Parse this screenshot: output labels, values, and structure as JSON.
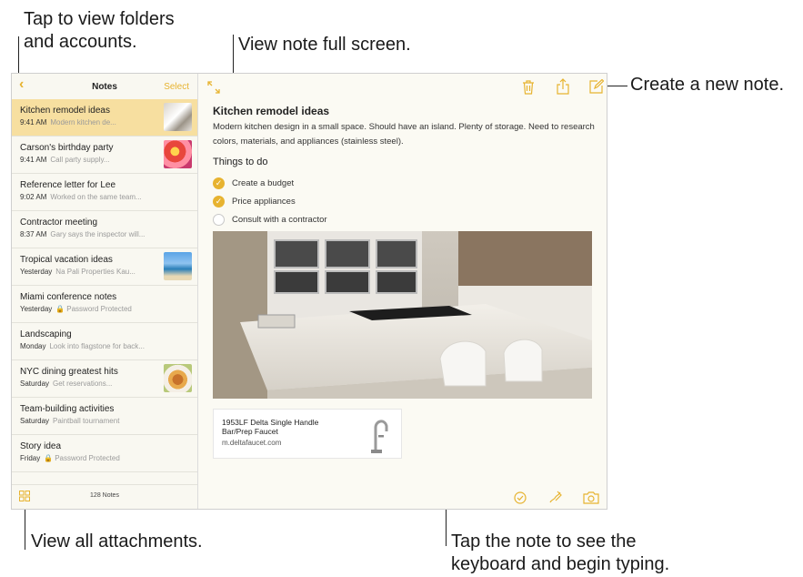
{
  "callouts": {
    "folders": "Tap to view folders\nand accounts.",
    "full_screen": "View note full screen.",
    "new_note": "Create a new note.",
    "attachments": "View all attachments.",
    "typing": "Tap the note to see the\nkeyboard and begin typing."
  },
  "sidebar": {
    "title": "Notes",
    "select_label": "Select",
    "note_count": "128 Notes",
    "notes": [
      {
        "title": "Kitchen remodel ideas",
        "time": "9:41 AM",
        "preview": "Modern kitchen de..."
      },
      {
        "title": "Carson's birthday party",
        "time": "9:41 AM",
        "preview": "Call party supply..."
      },
      {
        "title": "Reference letter for Lee",
        "time": "9:02 AM",
        "preview": "Worked on the same team..."
      },
      {
        "title": "Contractor meeting",
        "time": "8:37 AM",
        "preview": "Gary says the inspector will..."
      },
      {
        "title": "Tropical vacation ideas",
        "time": "Yesterday",
        "preview": "Na Pali Properties Kau..."
      },
      {
        "title": "Miami conference notes",
        "time": "Yesterday",
        "preview": "Password Protected"
      },
      {
        "title": "Landscaping",
        "time": "Monday",
        "preview": "Look into flagstone for back..."
      },
      {
        "title": "NYC dining greatest hits",
        "time": "Saturday",
        "preview": "Get reservations..."
      },
      {
        "title": "Team-building activities",
        "time": "Saturday",
        "preview": "Paintball tournament"
      },
      {
        "title": "Story idea",
        "time": "Friday",
        "preview": "Password Protected"
      }
    ]
  },
  "note": {
    "title": "Kitchen remodel ideas",
    "body": "Modern kitchen design in a small space. Should have an island. Plenty of storage. Need to research colors, materials, and appliances (stainless steel).",
    "things_heading": "Things to do",
    "checklist": [
      {
        "label": "Create a budget",
        "checked": true
      },
      {
        "label": "Price appliances",
        "checked": true
      },
      {
        "label": "Consult with a contractor",
        "checked": false
      }
    ],
    "link_card": {
      "title": "1953LF Delta Single Handle Bar/Prep Faucet",
      "url": "m.deltafaucet.com"
    }
  },
  "icons": {
    "back": "chevron-left-icon",
    "full_screen": "expand-icon",
    "delete": "trash-icon",
    "share": "share-icon",
    "compose": "compose-icon",
    "attachments": "grid-icon",
    "checklist": "checklist-icon",
    "sketch": "sketch-icon",
    "camera": "camera-icon"
  },
  "colors": {
    "accent": "#e7b330",
    "selected_row": "#f7dfa0",
    "background": "#fbfaf3"
  }
}
